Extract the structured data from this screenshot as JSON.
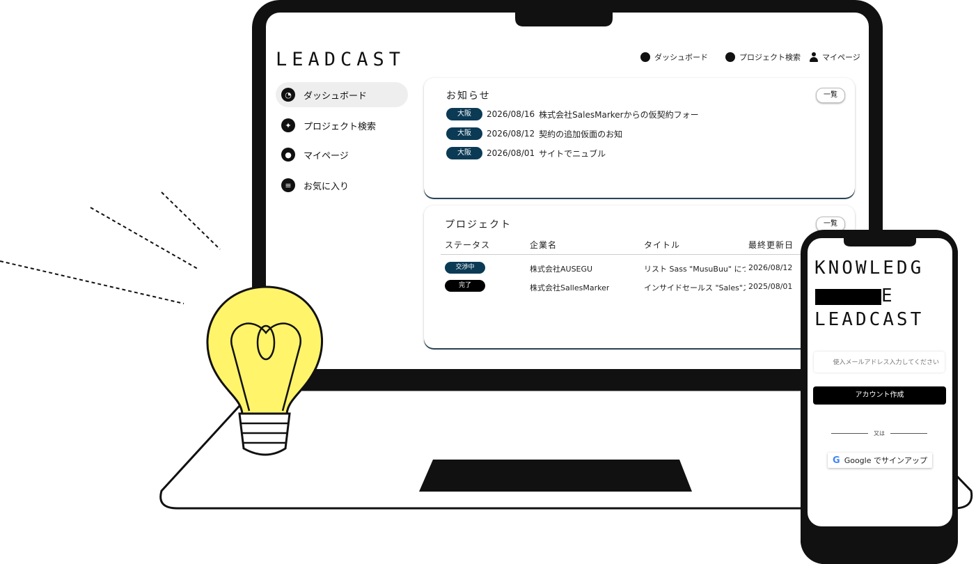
{
  "app": {
    "logo": "LEADCAST"
  },
  "topnav": {
    "dashboard": "ダッシュボード",
    "project_search": "プロジェクト検索",
    "mypage": "マイページ"
  },
  "sidebar": {
    "items": [
      {
        "label": "ダッシュボード",
        "icon": "clock-icon",
        "active": true
      },
      {
        "label": "プロジェクト検索",
        "icon": "runner-icon",
        "active": false
      },
      {
        "label": "マイページ",
        "icon": "user-icon",
        "active": false
      },
      {
        "label": "お気に入り",
        "icon": "list-icon",
        "active": false
      }
    ]
  },
  "news": {
    "title": "お知らせ",
    "view_all": "一覧",
    "items": [
      {
        "tag": "大阪",
        "date": "2026/08/16",
        "text": "株式会社SalesMarkerからの仮契約フォー"
      },
      {
        "tag": "大阪",
        "date": "2026/08/12",
        "text": "契約の追加仮面のお知"
      },
      {
        "tag": "大阪",
        "date": "2026/08/01",
        "text": "サイトでニュブル"
      }
    ]
  },
  "projects": {
    "title": "プロジェクト",
    "view_all": "一覧",
    "headers": {
      "status": "ステータス",
      "company": "企業名",
      "title": "タイトル",
      "date": "最終更新日"
    },
    "rows": [
      {
        "status": "交渉中",
        "company": "株式会社AUSEGU",
        "title": "リスト Sass \"MusuBuu\" につ",
        "date": "2026/08/12"
      },
      {
        "status": "完了",
        "company": "株式会社SallesMarker",
        "title": "インサイドセールス \"Sales\"ズ",
        "date": "2025/08/01"
      }
    ]
  },
  "phone": {
    "logo_line1": "KNOWLEDG",
    "logo_line2": "E",
    "logo_line3": "LEADCAST",
    "input_placeholder": "使入メールアドレス入力してください",
    "create_account": "アカウント作成",
    "or_text": "又は",
    "google_label": "Google でサインアップ",
    "google_icon": "G"
  },
  "colors": {
    "tag_navy": "#0b3a55",
    "card_accent": "#2f4e63",
    "bulb_yellow": "#fff46a"
  }
}
